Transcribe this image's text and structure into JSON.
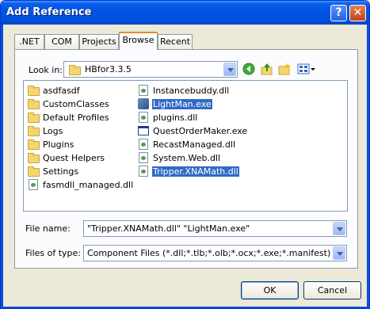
{
  "window": {
    "title": "Add Reference"
  },
  "title_buttons": {
    "help": "?",
    "close": "✕"
  },
  "tabs": [
    {
      "label": ".NET"
    },
    {
      "label": "COM"
    },
    {
      "label": "Projects"
    },
    {
      "label": "Browse",
      "active": true
    },
    {
      "label": "Recent"
    }
  ],
  "look_in": {
    "label": "Look in:",
    "value": "HBfor3.3.5"
  },
  "toolbar_icons": [
    "back-icon",
    "up-folder-icon",
    "new-folder-icon",
    "views-menu-icon"
  ],
  "files": {
    "col1": [
      {
        "name": "asdfasdf",
        "type": "folder"
      },
      {
        "name": "CustomClasses",
        "type": "folder"
      },
      {
        "name": "Default Profiles",
        "type": "folder"
      },
      {
        "name": "Logs",
        "type": "folder"
      },
      {
        "name": "Plugins",
        "type": "folder"
      },
      {
        "name": "Quest Helpers",
        "type": "folder"
      },
      {
        "name": "Settings",
        "type": "folder"
      },
      {
        "name": "fasmdll_managed.dll",
        "type": "dll"
      }
    ],
    "col2": [
      {
        "name": "Instancebuddy.dll",
        "type": "dll"
      },
      {
        "name": "LightMan.exe",
        "type": "exe",
        "selected": true
      },
      {
        "name": "plugins.dll",
        "type": "dll"
      },
      {
        "name": "QuestOrderMaker.exe",
        "type": "window-exe"
      },
      {
        "name": "RecastManaged.dll",
        "type": "dll"
      },
      {
        "name": "System.Web.dll",
        "type": "dll"
      },
      {
        "name": "Tripper.XNAMath.dll",
        "type": "dll",
        "selected": true
      }
    ]
  },
  "file_name": {
    "label": "File name:",
    "value": "\"Tripper.XNAMath.dll\" \"LightMan.exe\""
  },
  "files_of_type": {
    "label": "Files of type:",
    "value": "Component Files (*.dll;*.tlb;*.olb;*.ocx;*.exe;*.manifest)"
  },
  "buttons": {
    "ok": "OK",
    "cancel": "Cancel"
  },
  "colors": {
    "title_bar": "#0053e1",
    "selection": "#316ac5",
    "tab_highlight": "#e68b2c"
  }
}
